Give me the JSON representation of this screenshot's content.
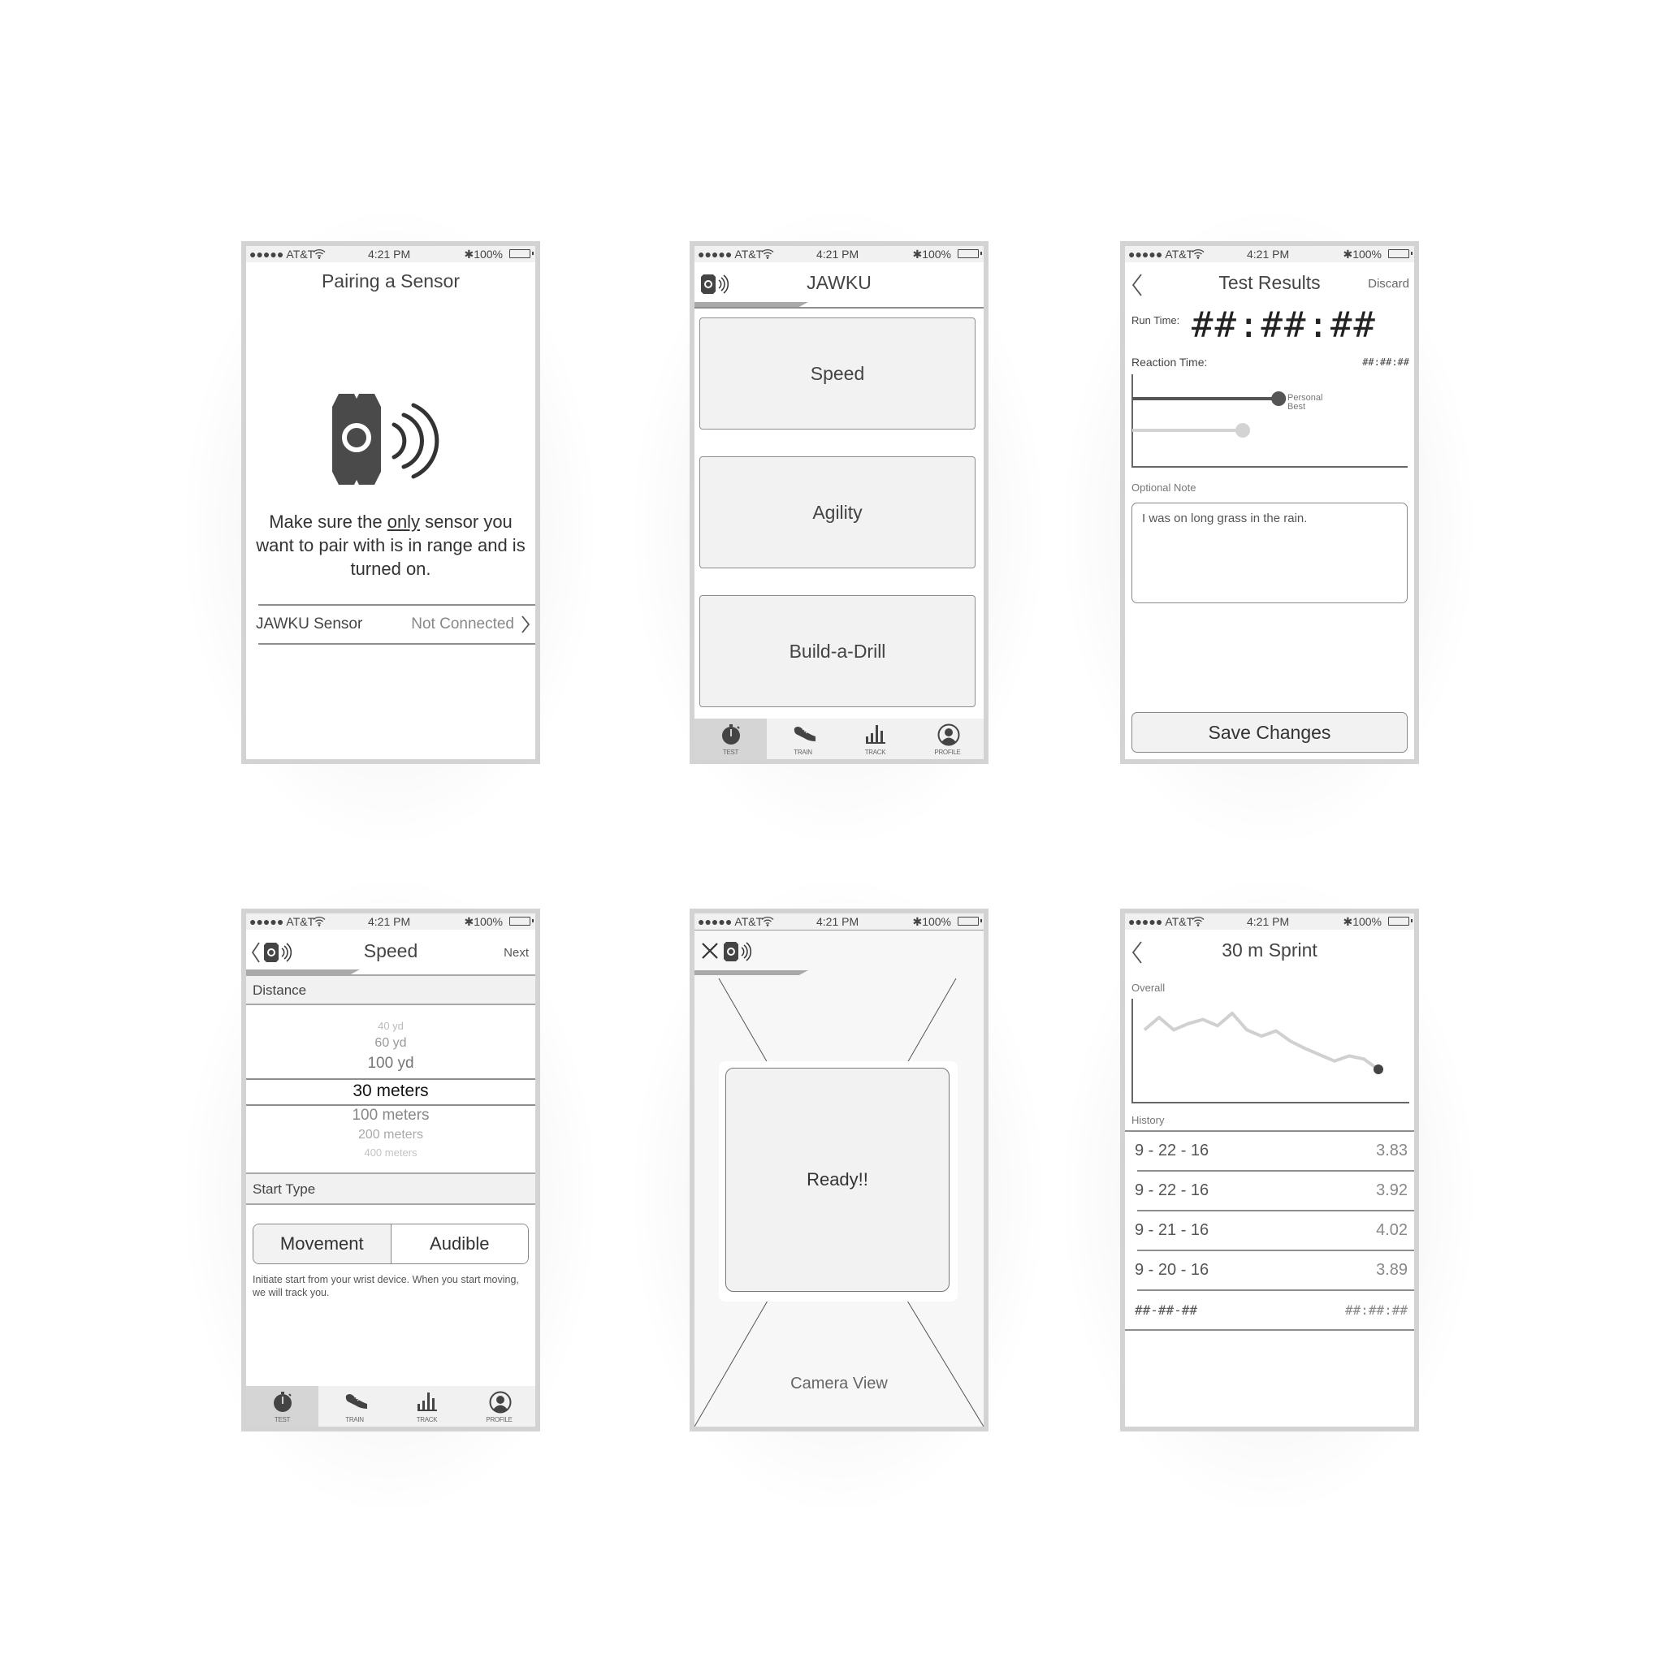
{
  "status_bar": {
    "carrier": "●●●●● AT&T",
    "time": "4:21 PM",
    "battery": "100%",
    "icons": [
      "signal-dots-icon",
      "wifi-icon",
      "bluetooth-icon",
      "battery-icon"
    ]
  },
  "screens": {
    "pairing": {
      "title": "Pairing a Sensor",
      "icon": "sensor-broadcast-icon",
      "message_pre": "Make sure the ",
      "message_emph": "only",
      "message_post": " sensor you want to pair with is in range and is turned on.",
      "row_label": "JAWKU Sensor",
      "row_status": "Not Connected",
      "row_icon": "chevron-right-icon"
    },
    "home": {
      "title": "JAWKU",
      "buttons": [
        "Speed",
        "Agility",
        "Build-a-Drill"
      ]
    },
    "results": {
      "title": "Test Results",
      "discard": "Discard",
      "run_time_label": "Run Time:",
      "run_time_value": "##:##:##",
      "reaction_label": "Reaction Time:",
      "reaction_value": "##:##:##",
      "personal_best_label": "Personal Best",
      "comparison": {
        "personal_best_fraction": 0.53,
        "current_fraction": 0.4
      },
      "note_label": "Optional Note",
      "note_value": "I was on long grass in the rain.",
      "save_button": "Save Changes"
    },
    "speed": {
      "title": "Speed",
      "next": "Next",
      "distance_label": "Distance",
      "distance_options": [
        "40 yd",
        "60 yd",
        "100 yd",
        "30 meters",
        "100 meters",
        "200 meters",
        "400 meters"
      ],
      "selected_distance": "30 meters",
      "start_type_label": "Start Type",
      "start_options": [
        "Movement",
        "Audible"
      ],
      "selected_start": "Movement",
      "start_description": "Initiate start from your wrist device.  When you start moving, we will track you."
    },
    "camera": {
      "ready_text": "Ready!!",
      "camera_label": "Camera View"
    },
    "sprint": {
      "title": "30 m Sprint",
      "overall_label": "Overall",
      "history_label": "History",
      "history": [
        {
          "date": "9 - 22 - 16",
          "value": "3.83"
        },
        {
          "date": "9 - 22 - 16",
          "value": "3.92"
        },
        {
          "date": "9 - 21 - 16",
          "value": "4.02"
        },
        {
          "date": "9 - 20 - 16",
          "value": "3.89"
        },
        {
          "date": "##-##-##",
          "value": "##:##:##"
        }
      ]
    }
  },
  "tabbar": {
    "items": [
      {
        "label": "TEST",
        "icon": "stopwatch-icon",
        "active": true
      },
      {
        "label": "TRAIN",
        "icon": "shoe-icon",
        "active": false
      },
      {
        "label": "TRACK",
        "icon": "bar-chart-icon",
        "active": false
      },
      {
        "label": "PROFILE",
        "icon": "profile-icon",
        "active": false
      }
    ]
  },
  "chart_data": {
    "type": "line",
    "title": "Overall",
    "xlabel": "",
    "ylabel": "",
    "x": [
      1,
      2,
      3,
      4,
      5,
      6,
      7,
      8,
      9,
      10,
      11,
      12,
      13,
      14,
      15,
      16,
      17,
      18
    ],
    "values": [
      0.7,
      0.82,
      0.7,
      0.76,
      0.8,
      0.74,
      0.86,
      0.7,
      0.64,
      0.69,
      0.59,
      0.52,
      0.46,
      0.4,
      0.45,
      0.42,
      0.32,
      null
    ],
    "highlight_last_point": true,
    "ylim": [
      0,
      1
    ],
    "grid": false
  }
}
